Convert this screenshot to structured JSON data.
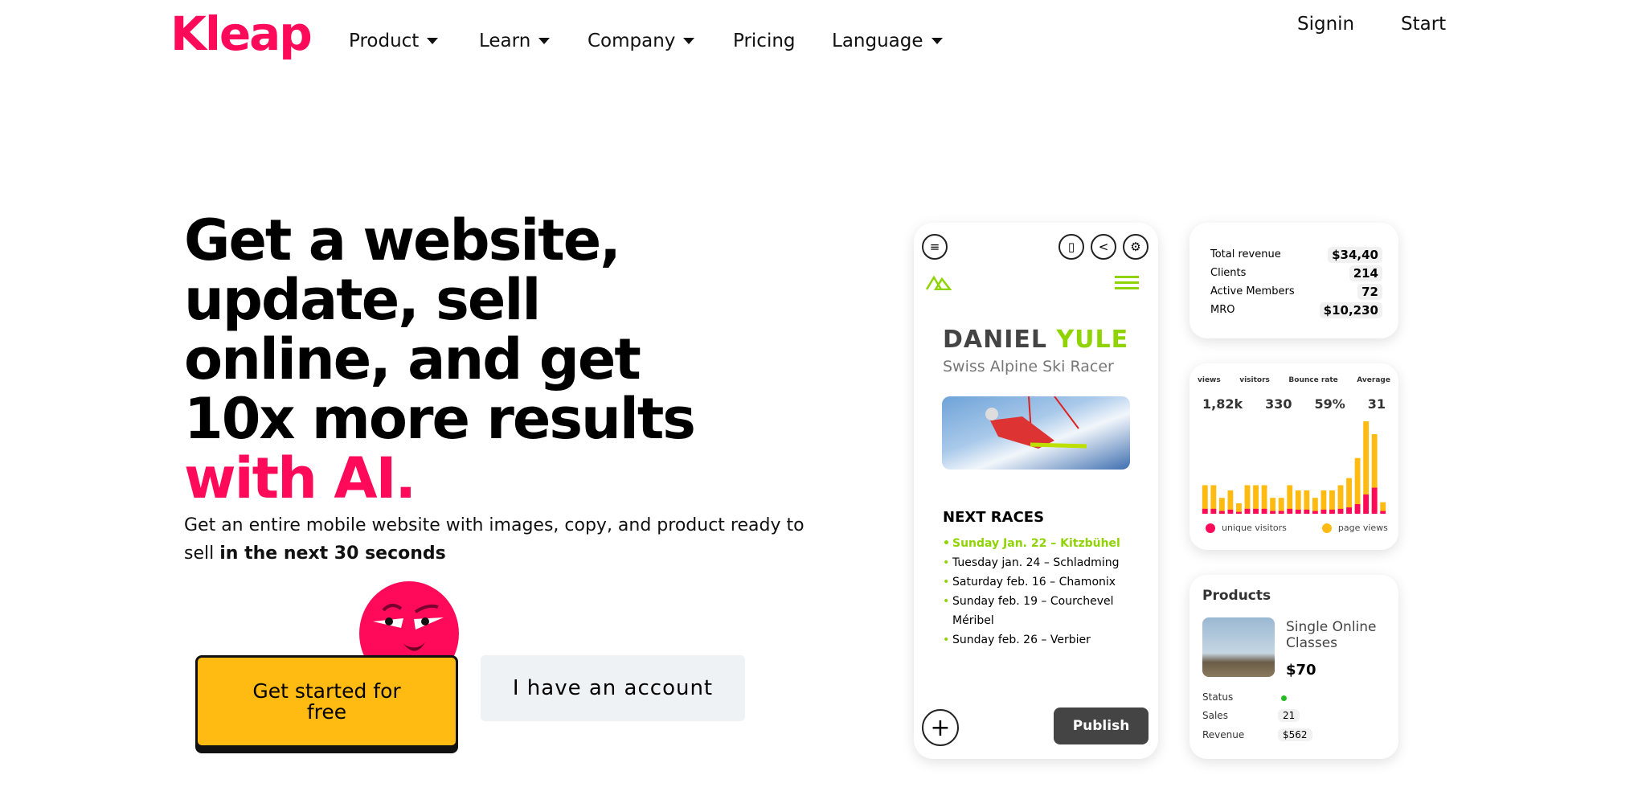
{
  "brand": {
    "logo": "Kleap",
    "accent": "#ff0a5a"
  },
  "nav": {
    "items": [
      {
        "label": "Product",
        "dropdown": true
      },
      {
        "label": "Learn",
        "dropdown": true
      },
      {
        "label": "Company",
        "dropdown": true
      },
      {
        "label": "Pricing",
        "dropdown": false
      },
      {
        "label": "Language",
        "dropdown": true
      }
    ],
    "signin": "Signin",
    "start": "Start"
  },
  "hero": {
    "headline_main": "Get a website, update, sell online, and get 10x more results ",
    "headline_accent": "with AI.",
    "sub_main": "Get an entire mobile website with images, copy, and product ready to sell ",
    "sub_bold": "in the next 30 seconds",
    "cta": "Get started for free",
    "account": "I have an account"
  },
  "phone": {
    "first_name": "DANIEL",
    "last_name": "YULE",
    "role": "Swiss Alpine Ski Racer",
    "races_title": "NEXT RACES",
    "races": [
      "Sunday Jan. 22 – Kitzbühel",
      "Tuesday jan. 24  – Schladming",
      "Saturday feb. 16 – Chamonix",
      "Sunday feb. 19 – Courchevel Méribel",
      "Sunday feb. 26 – Verbier"
    ],
    "publish": "Publish",
    "icons": [
      "menu-icon",
      "mobile-icon",
      "share-icon",
      "gear-icon",
      "mountain-logo-icon",
      "hamburger-icon",
      "plus-icon"
    ],
    "brand_green": "#8fd400"
  },
  "stats": [
    {
      "label": "Total revenue",
      "value": "$34,40"
    },
    {
      "label": "Clients",
      "value": "214"
    },
    {
      "label": "Active Members",
      "value": "72"
    },
    {
      "label": "MRO",
      "value": "$10,230"
    }
  ],
  "analytics": {
    "kpis": [
      {
        "label": "views",
        "value": "1,82k"
      },
      {
        "label": "visitors",
        "value": "330"
      },
      {
        "label": "Bounce rate",
        "value": "59%"
      },
      {
        "label": "Average",
        "value": "31"
      }
    ],
    "chart_data": {
      "type": "bar",
      "stacked": true,
      "series": [
        {
          "name": "unique visitors",
          "color": "#ff0a5a",
          "values": [
            18,
            18,
            10,
            15,
            7,
            18,
            18,
            18,
            10,
            10,
            18,
            15,
            15,
            10,
            15,
            15,
            18,
            23,
            35,
            70,
            95,
            10
          ]
        },
        {
          "name": "page views",
          "color": "#ffbb12",
          "values": [
            104,
            104,
            58,
            85,
            38,
            104,
            104,
            104,
            58,
            58,
            104,
            85,
            85,
            58,
            85,
            85,
            104,
            130,
            203,
            337,
            290,
            42
          ]
        }
      ],
      "legend": "bottom"
    }
  },
  "products": {
    "title": "Products",
    "name": "Single Online Classes",
    "price": "$70",
    "status_label": "Status",
    "status_color": "#22bb22",
    "sales_label": "Sales",
    "sales": "21",
    "revenue_label": "Revenue",
    "revenue": "$562"
  }
}
